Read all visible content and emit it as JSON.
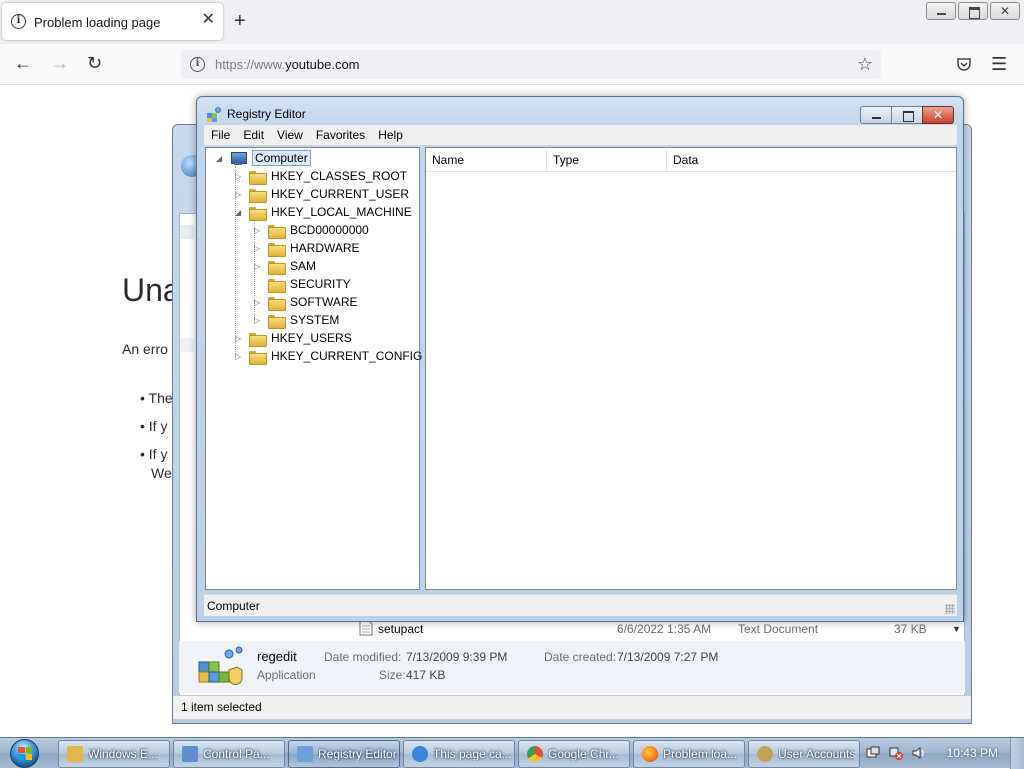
{
  "browser": {
    "tab_title": "Problem loading page",
    "url_dim_prefix": "https://www.",
    "url_host": "youtube.com"
  },
  "error_page": {
    "title_fragment": "Una",
    "text_fragment": "An erro",
    "bullets": [
      "The",
      "If y",
      "If y"
    ],
    "bullet_tail": "We"
  },
  "explorer": {
    "file_row": {
      "name": "setupact",
      "date": "6/6/2022 1:35 AM",
      "type": "Text Document",
      "size": "37 KB"
    },
    "details": {
      "name": "regedit",
      "kind": "Application",
      "modified_label": "Date modified:",
      "modified_value": "7/13/2009 9:39 PM",
      "created_label": "Date created:",
      "created_value": "7/13/2009 7:27 PM",
      "size_label": "Size:",
      "size_value": "417 KB"
    },
    "status": "1 item selected"
  },
  "regedit": {
    "title": "Registry Editor",
    "menu": [
      "File",
      "Edit",
      "View",
      "Favorites",
      "Help"
    ],
    "tree": {
      "root": "Computer",
      "hives": [
        "HKEY_CLASSES_ROOT",
        "HKEY_CURRENT_USER",
        "HKEY_LOCAL_MACHINE"
      ],
      "hklm_children": [
        "BCD00000000",
        "HARDWARE",
        "SAM",
        "SECURITY",
        "SOFTWARE",
        "SYSTEM"
      ],
      "hives_after": [
        "HKEY_USERS",
        "HKEY_CURRENT_CONFIG"
      ]
    },
    "columns": [
      "Name",
      "Type",
      "Data"
    ],
    "status": "Computer"
  },
  "taskbar": {
    "buttons": [
      {
        "label": "Windows E...",
        "icon": "folder-icon",
        "color": "#e2b84a"
      },
      {
        "label": "Control Pa...",
        "icon": "control-panel-icon",
        "color": "#5b8fd0"
      },
      {
        "label": "Registry Editor",
        "icon": "regedit-icon",
        "color": "#6aa1d8"
      },
      {
        "label": "This page ca...",
        "icon": "ie-icon",
        "color": "#3a86d6"
      },
      {
        "label": "Google Chr...",
        "icon": "chrome-icon",
        "color": "#e04b3b"
      },
      {
        "label": "Problem loa...",
        "icon": "firefox-icon",
        "color": "#ff7a1c"
      },
      {
        "label": "User Accounts",
        "icon": "user-accounts-icon",
        "color": "#c6a258"
      }
    ],
    "clock": "10:43 PM"
  }
}
